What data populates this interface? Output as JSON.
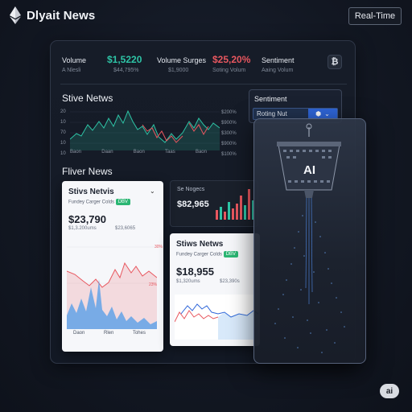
{
  "header": {
    "brand": "Dlyait News",
    "realtime_label": "Real-Time"
  },
  "stats": {
    "volume_label": "Volume",
    "volume_sub": "A Nlesli",
    "volume_value": "$1,5220",
    "volume_value_sub": "$44,795%",
    "surges_label": "Volume Surges",
    "surges_sub": "$1,9000",
    "surges_value": "$25,20%",
    "surges_value_sub": "Soting Volum",
    "sentiment_label": "Sentiment",
    "sentiment_sub": "Aaing Volum",
    "btc_icon": "₿"
  },
  "sentiment_panel": {
    "title": "Sentiment",
    "selected": "Roting  Nut",
    "icon_glyph": "⬢",
    "chevron": "⌄"
  },
  "stive_chart": {
    "title": "Stive Netws",
    "y_ticks": [
      "20",
      "10",
      "70",
      "10",
      "10"
    ],
    "x_ticks": [
      "Baon",
      "Daan",
      "Baon",
      "Taas",
      "Baon"
    ],
    "right_ticks": [
      "$200%",
      "$900%",
      "$300%",
      "$900%",
      "$100%"
    ]
  },
  "fliver": {
    "title": "Fliver News"
  },
  "card1": {
    "title": "Stivs Netvis",
    "subtitle": "Fundey Carger Colds",
    "badge": "DBV",
    "value": "$23,790",
    "sub_left": "$1,3.200ums",
    "sub_right": "$23,6065",
    "right_ticks": [
      "30%",
      "23%"
    ],
    "x_ticks": [
      "Daon",
      "Rlen",
      "Tohes"
    ]
  },
  "card_dark": {
    "label": "Se Nogecs",
    "value": "$82,965"
  },
  "card2": {
    "title": "Stiws Netws",
    "subtitle": "Fundey Carger Colds",
    "badge": "DBV",
    "value": "$18,955",
    "sub_left": "$1,320ums",
    "sub_right": "$23,390s"
  },
  "ai_panel": {
    "label": "AI"
  },
  "corner_badge": "ai",
  "colors": {
    "accent_green": "#2ec4a6",
    "accent_red": "#e8575f",
    "accent_blue": "#2f66d9",
    "background": "#121722"
  }
}
